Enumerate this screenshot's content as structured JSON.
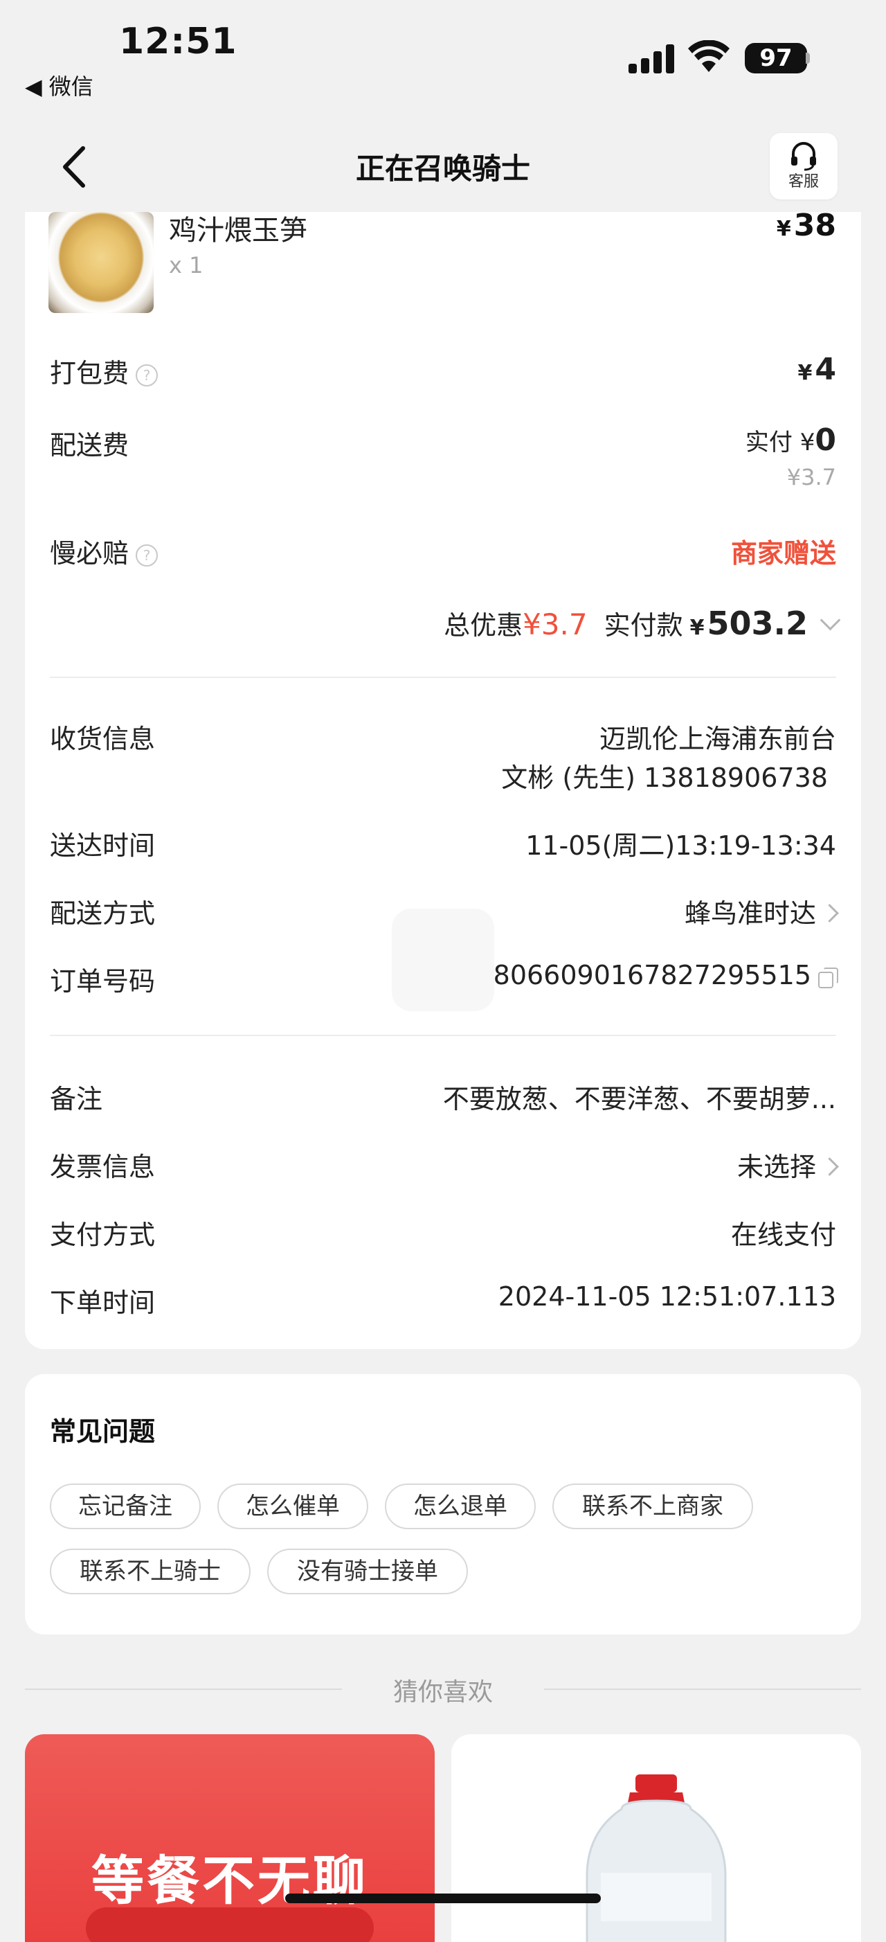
{
  "status_bar": {
    "time": "12:51",
    "back_app": "◀ 微信",
    "battery": "97"
  },
  "nav": {
    "title": "正在召唤骑士",
    "cs_label": "客服"
  },
  "dish": {
    "name": "鸡汁煨玉笋",
    "qty": "x 1",
    "currency": "¥",
    "price": "38"
  },
  "fees": {
    "packing_label": "打包费",
    "packing_currency": "¥",
    "packing_value": "4",
    "delivery_label": "配送费",
    "delivery_paid_prefix": "实付 ¥",
    "delivery_paid": "0",
    "delivery_original": "¥3.7",
    "slow_label": "慢必赔",
    "slow_value": "商家赠送"
  },
  "totals": {
    "discount_label": "总优惠",
    "discount_value": "¥3.7",
    "paid_label": "实付款",
    "paid_currency": "¥",
    "paid_value": "503.2"
  },
  "info": {
    "receiver_label": "收货信息",
    "receiver_addr": "迈凯伦上海浦东前台",
    "receiver_contact": "文彬 (先生) 13818906738",
    "time_label": "送达时间",
    "time_value": "11-05(周二)13:19-13:34",
    "method_label": "配送方式",
    "method_value": "蜂鸟准时达",
    "order_label": "订单号码",
    "order_value": "8066090167827295515"
  },
  "extra": {
    "note_label": "备注",
    "note_value": "不要放葱、不要洋葱、不要胡萝...",
    "invoice_label": "发票信息",
    "invoice_value": "未选择",
    "pay_label": "支付方式",
    "pay_value": "在线支付",
    "ordered_label": "下单时间",
    "ordered_value": "2024-11-05 12:51:07.113"
  },
  "faq": {
    "title": "常见问题",
    "chips": [
      "忘记备注",
      "怎么催单",
      "怎么退单",
      "联系不上商家",
      "联系不上骑士",
      "没有骑士接单"
    ]
  },
  "recommend": {
    "title": "猜你喜欢",
    "promo_title": "等餐不无聊"
  },
  "colors": {
    "accent_red": "#f0513b",
    "background": "#f1f1f1",
    "card": "#ffffff"
  }
}
